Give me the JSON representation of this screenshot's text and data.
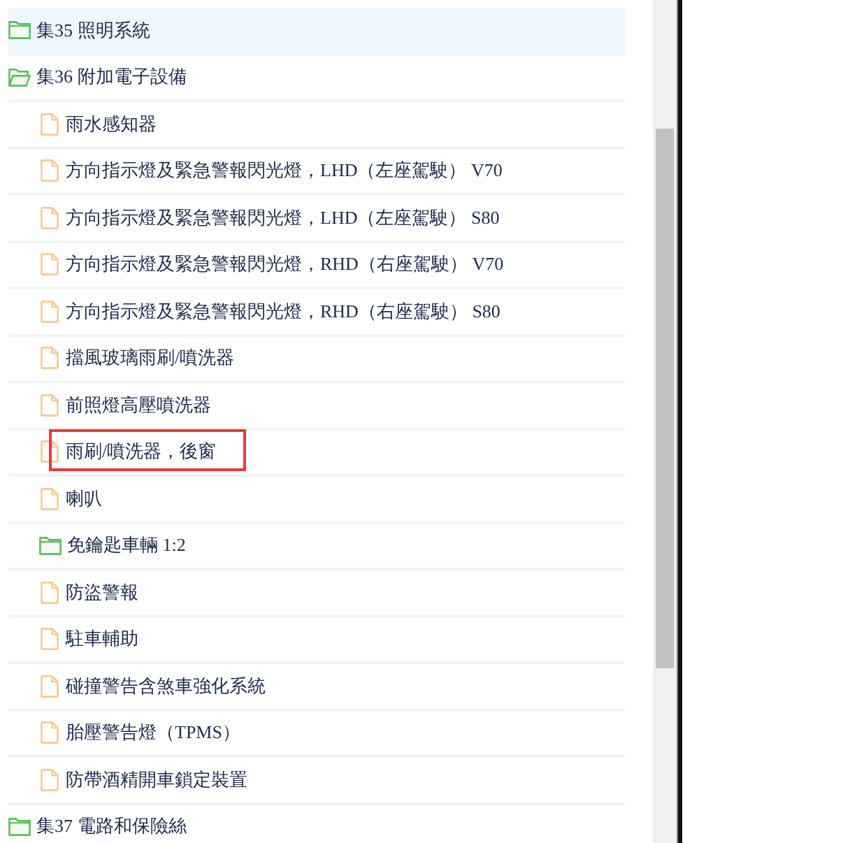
{
  "tree": [
    {
      "kind": "folder",
      "label": "集35 照明系統",
      "expanded": false,
      "selected": true,
      "annotated": false
    },
    {
      "kind": "folder",
      "label": "集36 附加電子設備",
      "expanded": true,
      "selected": false,
      "annotated": false,
      "children": [
        {
          "kind": "file",
          "label": "雨水感知器",
          "selected": false,
          "annotated": false
        },
        {
          "kind": "file",
          "label": "方向指示燈及緊急警報閃光燈，LHD（左座駕駛） V70",
          "selected": false,
          "annotated": false
        },
        {
          "kind": "file",
          "label": "方向指示燈及緊急警報閃光燈，LHD（左座駕駛） S80",
          "selected": false,
          "annotated": false
        },
        {
          "kind": "file",
          "label": "方向指示燈及緊急警報閃光燈，RHD（右座駕駛） V70",
          "selected": false,
          "annotated": false
        },
        {
          "kind": "file",
          "label": "方向指示燈及緊急警報閃光燈，RHD（右座駕駛） S80",
          "selected": false,
          "annotated": false
        },
        {
          "kind": "file",
          "label": "擋風玻璃雨刷/噴洗器",
          "selected": false,
          "annotated": false
        },
        {
          "kind": "file",
          "label": "前照燈高壓噴洗器",
          "selected": false,
          "annotated": false
        },
        {
          "kind": "file",
          "label": "雨刷/噴洗器，後窗",
          "selected": false,
          "annotated": true
        },
        {
          "kind": "file",
          "label": "喇叭",
          "selected": false,
          "annotated": false
        },
        {
          "kind": "folder",
          "label": "免鑰匙車輛 1:2",
          "expanded": false,
          "selected": false,
          "annotated": false
        },
        {
          "kind": "file",
          "label": "防盜警報",
          "selected": false,
          "annotated": false
        },
        {
          "kind": "file",
          "label": "駐車輔助",
          "selected": false,
          "annotated": false
        },
        {
          "kind": "file",
          "label": "碰撞警告含煞車強化系統",
          "selected": false,
          "annotated": false
        },
        {
          "kind": "file",
          "label": "胎壓警告燈（TPMS）",
          "selected": false,
          "annotated": false
        },
        {
          "kind": "file",
          "label": "防帶酒精開車鎖定裝置",
          "selected": false,
          "annotated": false
        }
      ]
    },
    {
      "kind": "folder",
      "label": "集37 電路和保險絲",
      "expanded": false,
      "selected": false,
      "annotated": false
    }
  ]
}
